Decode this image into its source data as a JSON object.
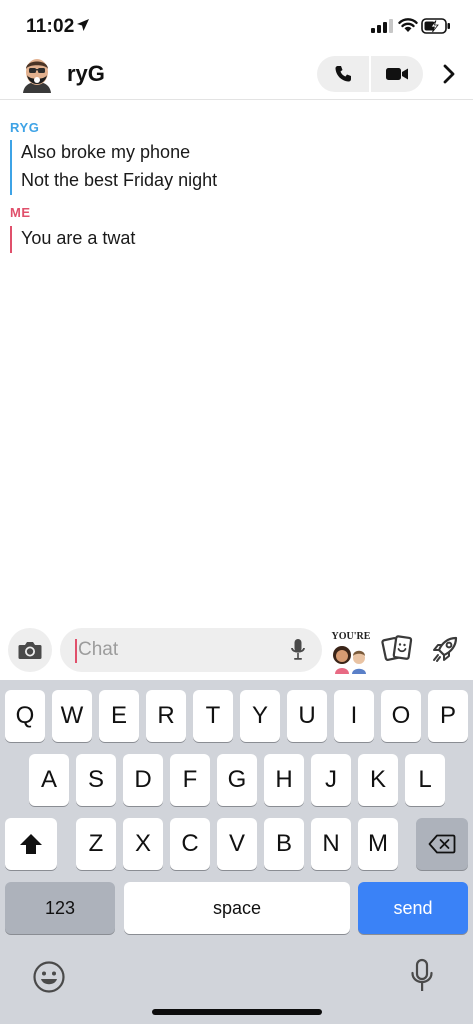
{
  "status": {
    "time": "11:02"
  },
  "header": {
    "title": "ryG"
  },
  "messages": [
    {
      "sender": "RYG",
      "lines": [
        "Also broke my phone",
        "Not the best Friday night"
      ]
    },
    {
      "sender": "ME",
      "lines": [
        "You are a twat"
      ]
    }
  ],
  "input": {
    "placeholder": "Chat",
    "bitmoji_text": "YOU'RE"
  },
  "keyboard": {
    "row1": [
      "Q",
      "W",
      "E",
      "R",
      "T",
      "Y",
      "U",
      "I",
      "O",
      "P"
    ],
    "row2": [
      "A",
      "S",
      "D",
      "F",
      "G",
      "H",
      "J",
      "K",
      "L"
    ],
    "row3": [
      "Z",
      "X",
      "C",
      "V",
      "B",
      "N",
      "M"
    ],
    "numbers_label": "123",
    "space_label": "space",
    "send_label": "send"
  },
  "colors": {
    "sender_ryg": "#3ea3e6",
    "sender_me": "#e0506b",
    "send_button": "#3a82f7",
    "keyboard_bg": "#d1d4da"
  },
  "icons": {
    "location": "location-arrow-icon",
    "signal": "cellular-signal-icon",
    "wifi": "wifi-icon",
    "battery": "battery-charging-icon",
    "phone": "phone-icon",
    "video": "video-camera-icon",
    "more": "chevron-right-icon",
    "camera": "camera-icon",
    "mic": "microphone-icon",
    "cards": "cards-icon",
    "rocket": "rocket-icon",
    "shift": "shift-icon",
    "backspace": "backspace-icon",
    "emoji": "emoji-icon",
    "dictation": "dictation-microphone-icon"
  }
}
